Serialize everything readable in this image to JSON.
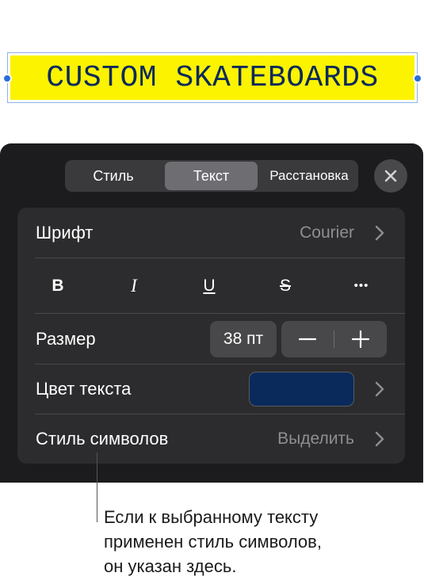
{
  "canvas": {
    "text": "CUSTOM SKATEBOARDS",
    "highlight_color": "#fbf300",
    "text_color": "#0c2a5a"
  },
  "panel": {
    "tabs": [
      {
        "label": "Стиль",
        "active": false
      },
      {
        "label": "Текст",
        "active": true
      },
      {
        "label": "Расстановка",
        "active": false
      }
    ],
    "close_icon": "close-icon",
    "font": {
      "label": "Шрифт",
      "value": "Courier"
    },
    "format_buttons": [
      {
        "name": "bold",
        "glyph": "B"
      },
      {
        "name": "italic",
        "glyph": "I"
      },
      {
        "name": "underline",
        "glyph": "U"
      },
      {
        "name": "strikethrough",
        "glyph": "S"
      },
      {
        "name": "more",
        "glyph": "•••"
      }
    ],
    "size": {
      "label": "Размер",
      "value": "38 пт"
    },
    "text_color": {
      "label": "Цвет текста",
      "swatch": "#0a2a5c"
    },
    "char_style": {
      "label": "Стиль символов",
      "value": "Выделить"
    }
  },
  "callout": {
    "lines": [
      "Если к выбранному тексту",
      "применен стиль символов,",
      "он указан здесь."
    ]
  }
}
